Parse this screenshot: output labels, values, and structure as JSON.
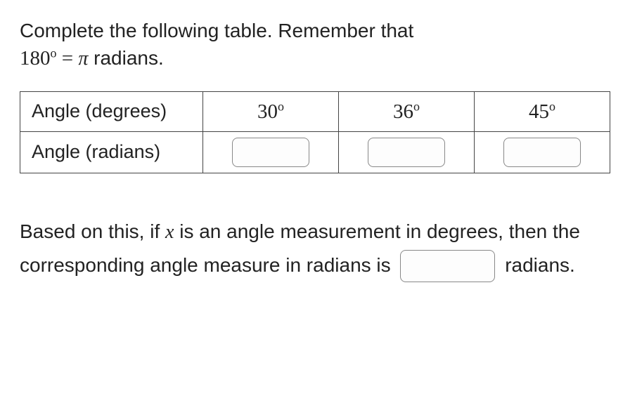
{
  "instructions": {
    "line1_pre": "Complete the following table. Remember that",
    "line2_deg_num": "180",
    "line2_deg_sym": "o",
    "line2_mid": " = ",
    "line2_pi": "π",
    "line2_tail": " radians."
  },
  "table": {
    "row1_label": "Angle (degrees)",
    "row2_label": "Angle (radians)",
    "cols": [
      {
        "deg_num": "30",
        "deg_sym": "o"
      },
      {
        "deg_num": "36",
        "deg_sym": "o"
      },
      {
        "deg_num": "45",
        "deg_sym": "o"
      }
    ]
  },
  "follow": {
    "chunk1": "Based on this, if ",
    "var": "x",
    "chunk2": " is an angle measurement in degrees, then the corresponding angle measure in radians is ",
    "chunk3": " radians."
  },
  "answers": {
    "rad_col1": "",
    "rad_col2": "",
    "rad_col3": "",
    "formula": ""
  }
}
